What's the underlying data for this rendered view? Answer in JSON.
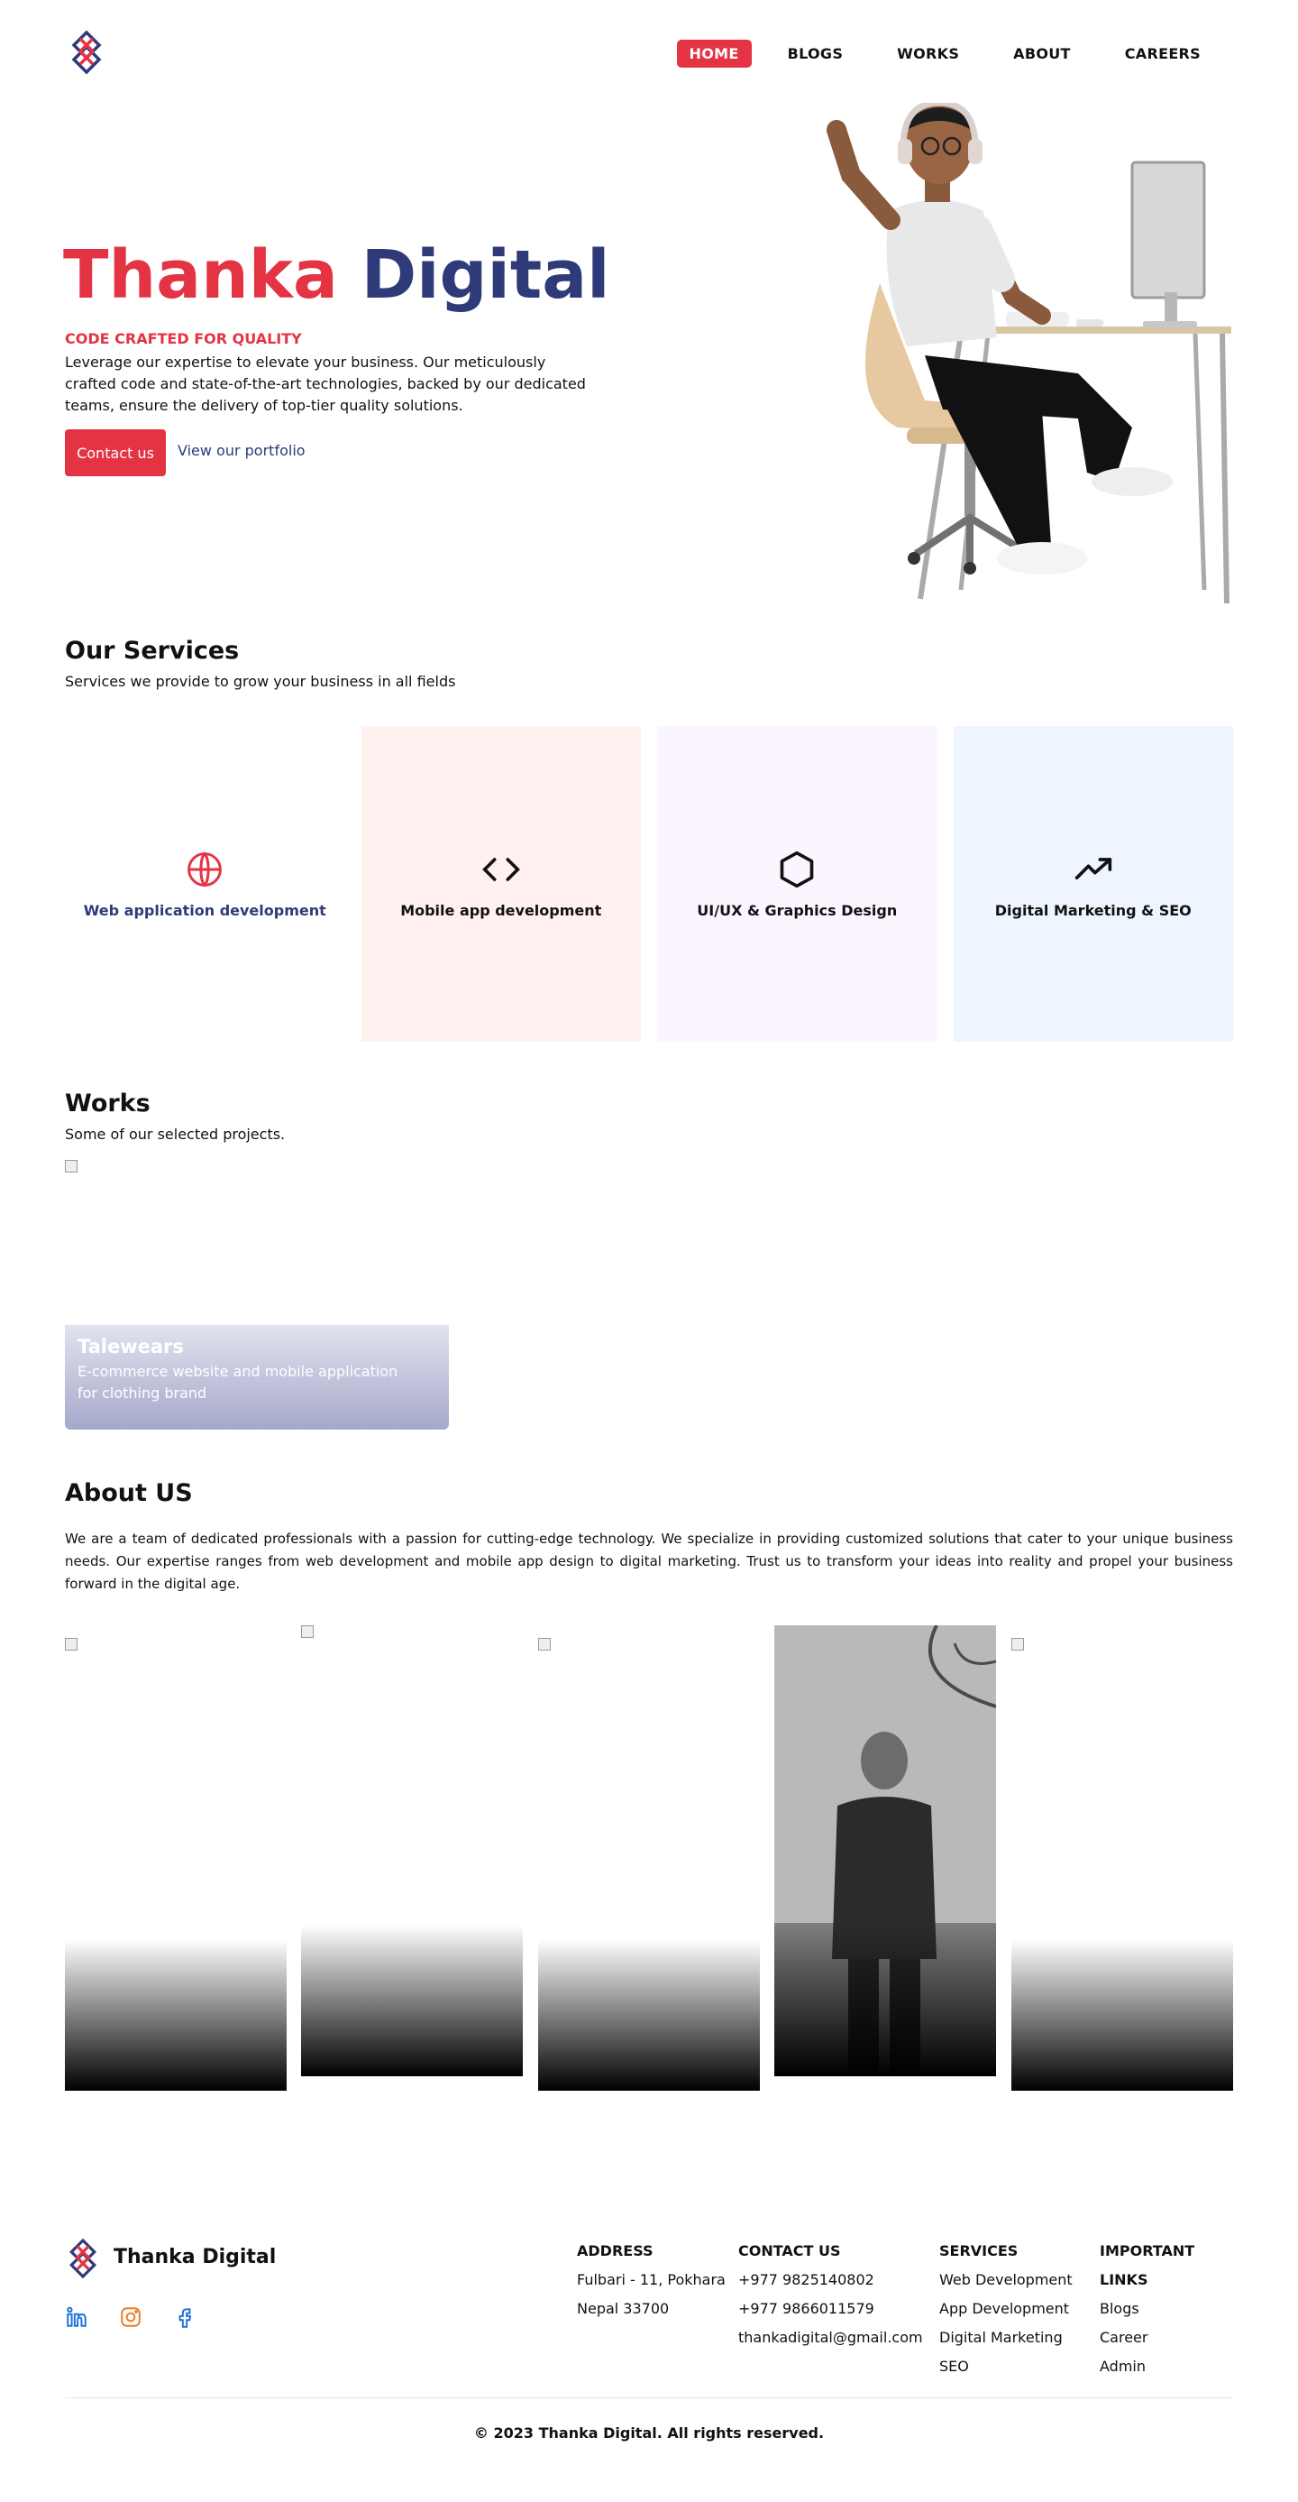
{
  "colors": {
    "red": "#e43444",
    "navy": "#2f3a78",
    "card_pink": "#fff1f0",
    "card_purple": "#faf5ff",
    "card_blue": "#eef5ff"
  },
  "nav": {
    "items": [
      "HOME",
      "BLOGS",
      "WORKS",
      "ABOUT",
      "CAREERS"
    ],
    "active": "HOME"
  },
  "hero": {
    "title_part1": "Thanka",
    "title_part2": "Digital",
    "tagline": "CODE CRAFTED FOR QUALITY",
    "description": "Leverage our expertise to elevate your business. Our meticulously crafted code and state-of-the-art technologies, backed by our dedicated teams, ensure the delivery of top-tier quality solutions.",
    "contact_button": "Contact us",
    "portfolio_link": "View our portfolio"
  },
  "services": {
    "title": "Our Services",
    "subtitle": "Services we provide to grow your business in all fields",
    "items": [
      {
        "label": "Web application development",
        "icon": "globe-icon"
      },
      {
        "label": "Mobile app development",
        "icon": "code-icon"
      },
      {
        "label": "UI/UX & Graphics Design",
        "icon": "hexagon-icon"
      },
      {
        "label": "Digital Marketing & SEO",
        "icon": "trending-up-icon"
      }
    ]
  },
  "works": {
    "title": "Works",
    "subtitle": "Some of our selected projects.",
    "items": [
      {
        "name": "Talewears",
        "description": "E-commerce website and mobile application for clothing brand"
      }
    ]
  },
  "about": {
    "title": "About US",
    "text": "We are a team of dedicated professionals with a passion for cutting-edge technology. We specialize in providing customized solutions that cater to your unique business needs. Our expertise ranges from web development and mobile app design to digital marketing. Trust us to transform your ideas into reality and propel your business forward in the digital age."
  },
  "footer": {
    "brand": "Thanka Digital",
    "social": [
      "linkedin-icon",
      "instagram-icon",
      "facebook-icon"
    ],
    "address": {
      "heading": "ADDRESS",
      "lines": [
        "Fulbari - 11, Pokhara",
        "Nepal 33700"
      ]
    },
    "contact": {
      "heading": "CONTACT US",
      "lines": [
        "+977 9825140802",
        "+977 9866011579",
        "thankadigital@gmail.com"
      ]
    },
    "services": {
      "heading": "SERVICES",
      "lines": [
        "Web Development",
        "App Development",
        "Digital Marketing",
        "SEO"
      ]
    },
    "links": {
      "heading": "IMPORTANT LINKS",
      "lines": [
        "Blogs",
        "Career",
        "Admin"
      ]
    },
    "copyright": "© 2023 Thanka Digital. All rights reserved."
  }
}
